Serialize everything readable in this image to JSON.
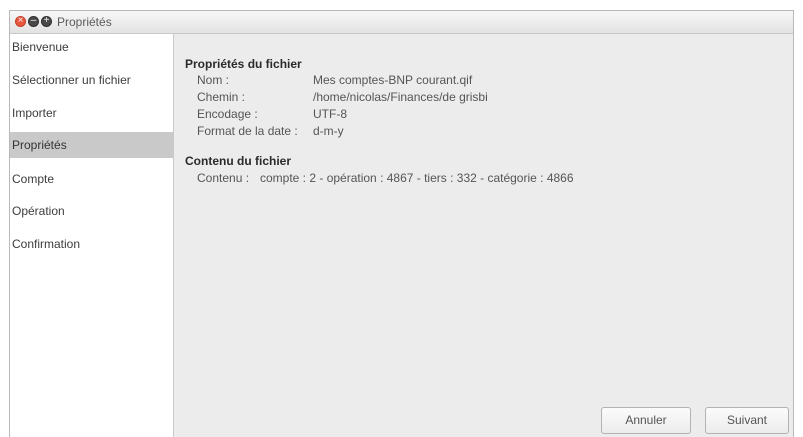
{
  "window": {
    "title": "Propriétés",
    "controls": {
      "close_glyph": "×",
      "minimize_glyph": "–",
      "maximize_glyph": "+"
    }
  },
  "sidebar": {
    "items": [
      {
        "label": "Bienvenue"
      },
      {
        "label": "Sélectionner un fichier"
      },
      {
        "label": "Importer"
      },
      {
        "label": "Propriétés",
        "selected": true
      },
      {
        "label": "Compte"
      },
      {
        "label": "Opération"
      },
      {
        "label": "Confirmation"
      }
    ]
  },
  "properties": {
    "section_title": "Propriétés du fichier",
    "rows": [
      {
        "label": "Nom :",
        "value": "Mes comptes-BNP courant.qif"
      },
      {
        "label": "Chemin :",
        "value": "/home/nicolas/Finances/de grisbi"
      },
      {
        "label": "Encodage :",
        "value": "UTF-8"
      },
      {
        "label": "Format de la date :",
        "value": "d-m-y"
      }
    ]
  },
  "contents": {
    "section_title": "Contenu du fichier",
    "label": "Contenu :",
    "value": "compte : 2 - opération : 4867 - tiers : 332 - catégorie : 4866"
  },
  "buttons": {
    "cancel": "Annuler",
    "next": "Suivant"
  },
  "colors": {
    "close_button": "#e9573f",
    "selected_item_bg": "#c9c9c9",
    "window_bg": "#ececec"
  }
}
